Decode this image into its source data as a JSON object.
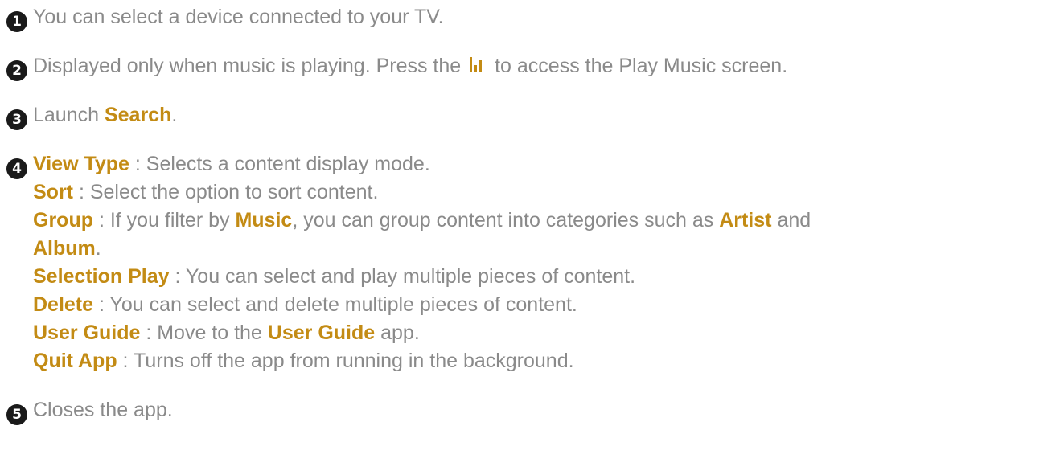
{
  "items": [
    {
      "number": "1",
      "text": "You can select a device connected to your TV."
    },
    {
      "number": "2",
      "text_before": "Displayed only when music is playing. Press the",
      "icon": "music-bars-icon",
      "text_after": "to access the Play Music screen."
    },
    {
      "number": "3",
      "text_before": "Launch ",
      "keyword": "Search",
      "text_after": "."
    },
    {
      "number": "4",
      "entries": [
        {
          "keyword": "View Type",
          "text": " : Selects a content display mode."
        },
        {
          "keyword": "Sort",
          "text": " : Select the option to sort content."
        },
        {
          "keyword": "Group",
          "text_a": " : If you filter by ",
          "kw_music": "Music",
          "text_b": ", you can group content into categories such as ",
          "kw_artist": "Artist",
          "text_c": " and",
          "kw_album": "Album",
          "text_d": "."
        },
        {
          "keyword": "Selection Play",
          "text": " : You can select and play multiple pieces of content."
        },
        {
          "keyword": "Delete",
          "text": " : You can select and delete multiple pieces of content."
        },
        {
          "keyword": "User Guide",
          "text_a": " : Move to the ",
          "kw_app": "User Guide",
          "text_b": " app."
        },
        {
          "keyword": "Quit App",
          "text": " : Turns off the app from running in the background."
        }
      ]
    },
    {
      "number": "5",
      "text": "Closes the app."
    }
  ],
  "colors": {
    "text": "#8a8a8a",
    "keyword": "#c38b14",
    "badge": "#1a1a1a"
  }
}
